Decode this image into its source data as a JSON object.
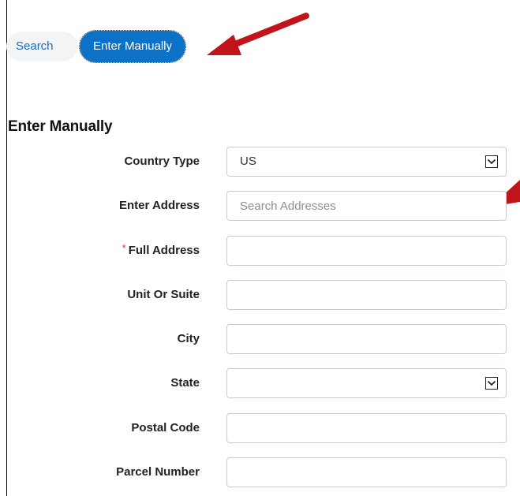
{
  "tabs": {
    "search_label": "Search",
    "manual_label": "Enter Manually"
  },
  "section": {
    "title": "Enter Manually"
  },
  "form": {
    "country_type": {
      "label": "Country Type",
      "value": "US"
    },
    "enter_address": {
      "label": "Enter Address",
      "placeholder": "Search Addresses"
    },
    "full_address": {
      "label": "Full Address",
      "required_mark": "*",
      "value": ""
    },
    "unit_or_suite": {
      "label": "Unit Or Suite",
      "value": ""
    },
    "city": {
      "label": "City",
      "value": ""
    },
    "state": {
      "label": "State",
      "value": ""
    },
    "postal_code": {
      "label": "Postal Code",
      "value": ""
    },
    "parcel_number": {
      "label": "Parcel Number",
      "value": ""
    }
  },
  "colors": {
    "accent": "#0b72c8",
    "arrow": "#c0141a",
    "required": "#d9342b"
  }
}
